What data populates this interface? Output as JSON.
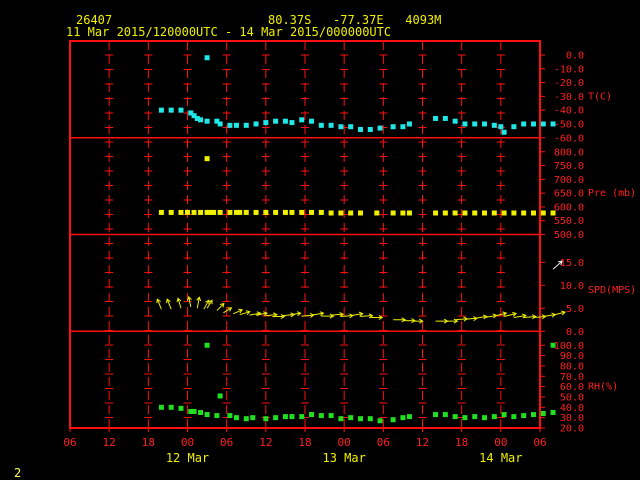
{
  "header": {
    "station": "26407",
    "location": "80.37S   -77.37E   4093M",
    "range": "11 Mar 2015/120000UTC - 14 Mar 2015/000000UTC",
    "page": "2"
  },
  "colors": {
    "background": "#000000",
    "frame": "#ff1010",
    "header_text": "#f0f000",
    "axis_text": "#ff2020",
    "temperature": "#20e8e8",
    "pressure": "#f0f000",
    "wind": "#f0f000",
    "wind_highlight": "#ffffff",
    "humidity": "#20e020"
  },
  "chart_data": {
    "type": "scatter",
    "x_unit": "hours since 11 Mar 06 UTC",
    "x_ticks": [
      "06",
      "12",
      "18",
      "00",
      "06",
      "12",
      "18",
      "00",
      "06",
      "12",
      "18",
      "00",
      "06"
    ],
    "date_labels": [
      {
        "text": "12 Mar",
        "at_hour": 18
      },
      {
        "text": "13 Mar",
        "at_hour": 42
      },
      {
        "text": "14 Mar",
        "at_hour": 66
      }
    ],
    "panels": [
      {
        "id": "temperature",
        "ylabel": "T(C)",
        "yticks": [
          "0.0",
          "-10.0",
          "-20.0",
          "-30.0",
          "-40.0",
          "-50.0",
          "-60.0"
        ],
        "ylim": [
          -60,
          0
        ],
        "color_key": "temperature",
        "points": [
          [
            14,
            -40
          ],
          [
            15.5,
            -40
          ],
          [
            17,
            -40
          ],
          [
            18.5,
            -42
          ],
          [
            19,
            -44
          ],
          [
            19.5,
            -46
          ],
          [
            20,
            -47
          ],
          [
            21,
            -48
          ],
          [
            21,
            -2
          ],
          [
            22.5,
            -48
          ],
          [
            23,
            -50
          ],
          [
            24.5,
            -51
          ],
          [
            25.5,
            -51
          ],
          [
            27,
            -51
          ],
          [
            28.5,
            -50
          ],
          [
            30,
            -49
          ],
          [
            31.5,
            -48
          ],
          [
            33,
            -48
          ],
          [
            34,
            -49
          ],
          [
            35.5,
            -47
          ],
          [
            37,
            -48
          ],
          [
            38.5,
            -51
          ],
          [
            40,
            -51
          ],
          [
            41.5,
            -52
          ],
          [
            43,
            -52
          ],
          [
            44.5,
            -54
          ],
          [
            46,
            -54
          ],
          [
            47.5,
            -53
          ],
          [
            49.5,
            -52
          ],
          [
            51,
            -52
          ],
          [
            52,
            -50
          ],
          [
            56,
            -46
          ],
          [
            57.5,
            -46
          ],
          [
            59,
            -48
          ],
          [
            60.5,
            -50
          ],
          [
            62,
            -50
          ],
          [
            63.5,
            -50
          ],
          [
            65,
            -51
          ],
          [
            66,
            -52
          ],
          [
            66.5,
            -56
          ],
          [
            68,
            -52
          ],
          [
            69.5,
            -50
          ],
          [
            71,
            -50
          ],
          [
            72.5,
            -50
          ],
          [
            74,
            -50
          ]
        ]
      },
      {
        "id": "pressure",
        "ylabel": "Pre (mb)",
        "yticks": [
          "800.0",
          "750.0",
          "700.0",
          "650.0",
          "600.0",
          "550.0",
          "500.0"
        ],
        "ylim": [
          500,
          800
        ],
        "color_key": "pressure",
        "points": [
          [
            14,
            580
          ],
          [
            15.5,
            580
          ],
          [
            17,
            580
          ],
          [
            18,
            580
          ],
          [
            19,
            580
          ],
          [
            20,
            580
          ],
          [
            21,
            580
          ],
          [
            21.5,
            580
          ],
          [
            22,
            580
          ],
          [
            23,
            580
          ],
          [
            24.5,
            580
          ],
          [
            25.5,
            580
          ],
          [
            26,
            580
          ],
          [
            27,
            580
          ],
          [
            28.5,
            580
          ],
          [
            30,
            580
          ],
          [
            31.5,
            580
          ],
          [
            33,
            580
          ],
          [
            34,
            580
          ],
          [
            35.5,
            580
          ],
          [
            21,
            775
          ],
          [
            37,
            580
          ],
          [
            38.5,
            580
          ],
          [
            40,
            578
          ],
          [
            41.5,
            578
          ],
          [
            43,
            578
          ],
          [
            44.5,
            578
          ],
          [
            47,
            578
          ],
          [
            49.5,
            578
          ],
          [
            51,
            578
          ],
          [
            52,
            578
          ],
          [
            56,
            578
          ],
          [
            57.5,
            578
          ],
          [
            59,
            578
          ],
          [
            60.5,
            578
          ],
          [
            62,
            578
          ],
          [
            63.5,
            578
          ],
          [
            65,
            578
          ],
          [
            66.5,
            578
          ],
          [
            68,
            578
          ],
          [
            69.5,
            578
          ],
          [
            71,
            578
          ],
          [
            72.5,
            578
          ],
          [
            74,
            578
          ]
        ]
      },
      {
        "id": "wind",
        "ylabel": "SPD(MPS)",
        "yticks": [
          "15.0",
          "10.0",
          "5.0",
          "0.0"
        ],
        "ylim": [
          0,
          18
        ],
        "color_key": "wind",
        "barbs": [
          [
            14,
            4.8,
            -4,
            -10
          ],
          [
            15.5,
            4.8,
            -4,
            -10
          ],
          [
            17,
            5,
            -3,
            -10
          ],
          [
            18.5,
            5.3,
            -2,
            -10
          ],
          [
            19.5,
            5,
            2,
            -11
          ],
          [
            20.5,
            4.8,
            5,
            -9
          ],
          [
            21,
            5,
            5,
            -8
          ],
          [
            22.5,
            4.5,
            7,
            -7
          ],
          [
            23.5,
            4,
            8,
            -5
          ],
          [
            25,
            3.8,
            9,
            -4
          ],
          [
            26,
            3.6,
            10,
            -3
          ],
          [
            27.5,
            3.5,
            11,
            -2
          ],
          [
            28.5,
            3.5,
            11,
            -2
          ],
          [
            30,
            3.4,
            11,
            -1
          ],
          [
            31,
            3.2,
            12,
            0
          ],
          [
            32.5,
            3.4,
            12,
            -1
          ],
          [
            33.5,
            3.5,
            12,
            -2
          ],
          [
            35.5,
            3.3,
            12,
            -1
          ],
          [
            37,
            3.5,
            12,
            -2
          ],
          [
            38.5,
            3.3,
            12,
            0
          ],
          [
            40,
            3.5,
            12,
            -1
          ],
          [
            41.5,
            3.2,
            12,
            -1
          ],
          [
            43,
            3.4,
            12,
            -2
          ],
          [
            44.5,
            3.2,
            12,
            -1
          ],
          [
            46,
            3,
            12,
            0
          ],
          [
            49.5,
            2.5,
            12,
            0
          ],
          [
            51,
            2.3,
            12,
            0
          ],
          [
            52.5,
            2.2,
            10,
            0
          ],
          [
            56,
            2.2,
            12,
            0
          ],
          [
            57.5,
            2.2,
            12,
            0
          ],
          [
            59,
            2.5,
            12,
            -1
          ],
          [
            60.5,
            2.6,
            12,
            -1
          ],
          [
            62,
            2.8,
            12,
            -2
          ],
          [
            63.5,
            3,
            12,
            -2
          ],
          [
            65,
            3.3,
            12,
            -3
          ],
          [
            66.5,
            3.2,
            12,
            -3
          ],
          [
            68,
            3,
            12,
            -2
          ],
          [
            69.5,
            3,
            12,
            -1
          ],
          [
            71,
            3,
            12,
            -1
          ],
          [
            72.5,
            3.2,
            12,
            -2
          ],
          [
            74,
            3.5,
            12,
            -3
          ],
          [
            74,
            13.5,
            9,
            -8
          ]
        ]
      },
      {
        "id": "humidity",
        "ylabel": "RH(%)",
        "yticks": [
          "100.0",
          "90.0",
          "80.0",
          "70.0",
          "60.0",
          "50.0",
          "40.0",
          "30.0",
          "20.0"
        ],
        "ylim": [
          20,
          100
        ],
        "color_key": "humidity",
        "points": [
          [
            14,
            40
          ],
          [
            15.5,
            40
          ],
          [
            17,
            39
          ],
          [
            18.5,
            36
          ],
          [
            19,
            36
          ],
          [
            20,
            35
          ],
          [
            21,
            100
          ],
          [
            21,
            33
          ],
          [
            22.5,
            32
          ],
          [
            23,
            51
          ],
          [
            24.5,
            32
          ],
          [
            25.5,
            30
          ],
          [
            27,
            29
          ],
          [
            28,
            30
          ],
          [
            30,
            29
          ],
          [
            31.5,
            30
          ],
          [
            33,
            31
          ],
          [
            34,
            31
          ],
          [
            35.5,
            31
          ],
          [
            37,
            33
          ],
          [
            38.5,
            32
          ],
          [
            40,
            32
          ],
          [
            41.5,
            29
          ],
          [
            43,
            30
          ],
          [
            44.5,
            29
          ],
          [
            46,
            29
          ],
          [
            47.5,
            27
          ],
          [
            49.5,
            28
          ],
          [
            51,
            30
          ],
          [
            52,
            31
          ],
          [
            56,
            33
          ],
          [
            57.5,
            33
          ],
          [
            59,
            31
          ],
          [
            60.5,
            30
          ],
          [
            62,
            31
          ],
          [
            63.5,
            30
          ],
          [
            65,
            31
          ],
          [
            66.5,
            33
          ],
          [
            68,
            31
          ],
          [
            69.5,
            32
          ],
          [
            71,
            33
          ],
          [
            72.5,
            34
          ],
          [
            74,
            35
          ],
          [
            74,
            100
          ]
        ]
      }
    ]
  }
}
